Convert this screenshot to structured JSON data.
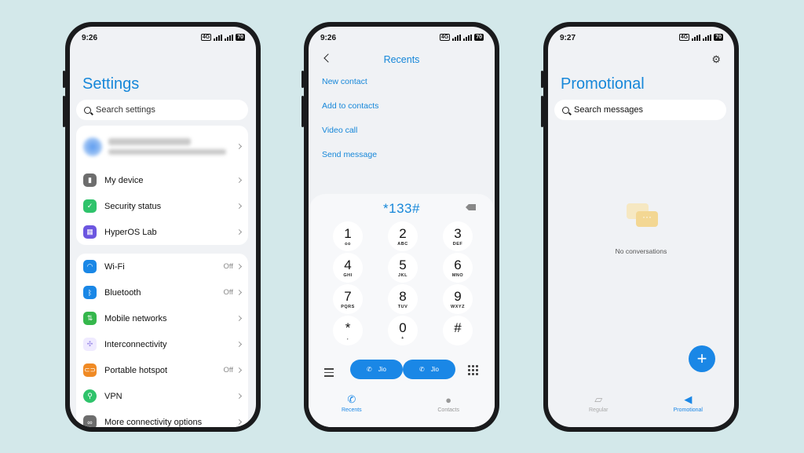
{
  "settings": {
    "time": "9:26",
    "battery": "70",
    "title": "Settings",
    "search_placeholder": "Search settings",
    "group1": [
      {
        "label": "My device",
        "icon": "phone-icon",
        "color": "#6d6d6d"
      },
      {
        "label": "Security status",
        "icon": "shield-check-icon",
        "color": "#2fc36b"
      },
      {
        "label": "HyperOS Lab",
        "icon": "apps-grid-icon",
        "color": "#6c56e0"
      }
    ],
    "group2": [
      {
        "label": "Wi-Fi",
        "value": "Off",
        "icon": "wifi-icon",
        "color": "#1a87e6"
      },
      {
        "label": "Bluetooth",
        "value": "Off",
        "icon": "bluetooth-icon",
        "color": "#1a87e6"
      },
      {
        "label": "Mobile networks",
        "value": "",
        "icon": "signal-bars-icon",
        "color": "#35b74c"
      },
      {
        "label": "Interconnectivity",
        "value": "",
        "icon": "interconnect-icon",
        "color": "#9b8be8"
      },
      {
        "label": "Portable hotspot",
        "value": "Off",
        "icon": "hotspot-link-icon",
        "color": "#f08a24"
      },
      {
        "label": "VPN",
        "value": "",
        "icon": "vpn-icon",
        "color": "#2fc36b"
      },
      {
        "label": "More connectivity options",
        "value": "",
        "icon": "link-icon",
        "color": "#6d6d6d"
      }
    ]
  },
  "dialer": {
    "time": "9:26",
    "battery": "70",
    "title": "Recents",
    "options": [
      "New contact",
      "Add to contacts",
      "Video call",
      "Send message"
    ],
    "number": "*133#",
    "keys": [
      {
        "d": "1",
        "l": "ᴑᴑ"
      },
      {
        "d": "2",
        "l": "ABC"
      },
      {
        "d": "3",
        "l": "DEF"
      },
      {
        "d": "4",
        "l": "GHI"
      },
      {
        "d": "5",
        "l": "JKL"
      },
      {
        "d": "6",
        "l": "MNO"
      },
      {
        "d": "7",
        "l": "PQRS"
      },
      {
        "d": "8",
        "l": "TUV"
      },
      {
        "d": "9",
        "l": "WXYZ"
      },
      {
        "d": "*",
        "l": ","
      },
      {
        "d": "0",
        "l": "+"
      },
      {
        "d": "#",
        "l": ""
      }
    ],
    "sim1_label": "Jio",
    "sim2_label": "Jio",
    "nav": {
      "recents": "Recents",
      "contacts": "Contacts"
    }
  },
  "messages": {
    "time": "9:27",
    "battery": "70",
    "title": "Promotional",
    "search_placeholder": "Search messages",
    "empty_text": "No conversations",
    "fab_label": "+",
    "nav": {
      "regular": "Regular",
      "promotional": "Promotional"
    }
  },
  "colors": {
    "accent": "#1687d9",
    "background": "#d3e8ea"
  }
}
